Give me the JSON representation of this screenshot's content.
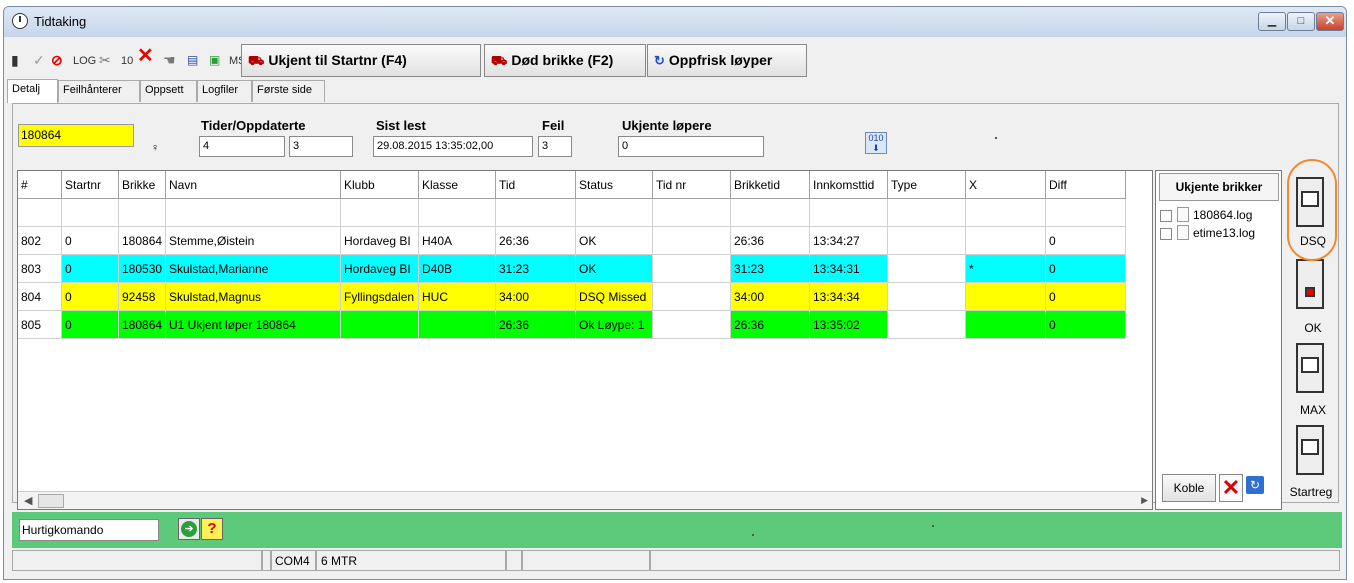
{
  "window": {
    "title": "Tidtaking",
    "minimize": "▁",
    "maximize": "□",
    "close": "✕"
  },
  "toolbar": {
    "log_label": "LOG",
    "ten_label": "10",
    "ms_label": "MS",
    "unknown_to_startnr": "Ukjent til Startnr (F4)",
    "dead_chip": "Død brikke (F2)",
    "refresh_courses": "Oppfrisk løyper"
  },
  "tabs": [
    "Detalj",
    "Feilhånterer",
    "Oppsett",
    "Logfiler",
    "Første side"
  ],
  "form": {
    "chip_value": "180864",
    "times_label": "Tider/Oppdaterte",
    "times_value": "4",
    "updated_value": "3",
    "last_read_label": "Sist lest",
    "last_read_value": "29.08.2015 13:35:02,00",
    "errors_label": "Feil",
    "errors_value": "3",
    "unknown_runners_label": "Ukjente løpere",
    "unknown_runners_value": "0",
    "download_icon_text": "010"
  },
  "grid": {
    "columns": [
      "#",
      "Startnr",
      "Brikke",
      "Navn",
      "Klubb",
      "Klasse",
      "Tid",
      "Status",
      "Tid nr",
      "Brikketid",
      "Innkomsttid",
      "Type",
      "X",
      "Diff"
    ],
    "rows": [
      {
        "color": "#ffffff",
        "cells": [
          "",
          "",
          "",
          "",
          "",
          "",
          "",
          "",
          "",
          "",
          "",
          "",
          "",
          ""
        ]
      },
      {
        "color": "#ffffff",
        "cells": [
          "802",
          "0",
          "180864",
          "Stemme,Øistein",
          "Hordaveg BI",
          "H40A",
          "26:36",
          "OK",
          "",
          "26:36",
          "13:34:27",
          "",
          "",
          "0"
        ]
      },
      {
        "color": "#00ffff",
        "cells": [
          "803",
          "0",
          "180530",
          "Skulstad,Marianne",
          "Hordaveg BI",
          "D40B",
          "31:23",
          "OK",
          "",
          "31:23",
          "13:34:31",
          "",
          "*",
          "0"
        ]
      },
      {
        "color": "#ffff00",
        "cells": [
          "804",
          "0",
          "92458",
          "Skulstad,Magnus",
          "Fyllingsdalen",
          "HUC",
          "34:00",
          "DSQ Missed",
          "",
          "34:00",
          "13:34:34",
          "",
          "",
          "0"
        ]
      },
      {
        "color": "#00ff00",
        "cells": [
          "805",
          "0",
          "180864",
          "U1 Ukjent løper 180864",
          "",
          "",
          "26:36",
          "Ok Løype: 1",
          "",
          "26:36",
          "13:35:02",
          "",
          "",
          "0"
        ]
      }
    ]
  },
  "unknown_chips": {
    "header": "Ukjente brikker",
    "items": [
      "180864.log",
      "etime13.log"
    ],
    "connect_label": "Koble"
  },
  "side_switches": [
    "DSQ",
    "OK",
    "MAX",
    "Startreg"
  ],
  "quick_command": {
    "placeholder": "Hurtigkomando",
    "go": "➔",
    "help": "?"
  },
  "statusbar": [
    "",
    "",
    "COM4",
    "6 MTR",
    "",
    "",
    ""
  ],
  "colors": {
    "yellow": "#ffff00",
    "cyan": "#00ffff",
    "green": "#00ff00",
    "bottom_green": "#5cc97b",
    "highlight_ring": "#f08a2b"
  }
}
